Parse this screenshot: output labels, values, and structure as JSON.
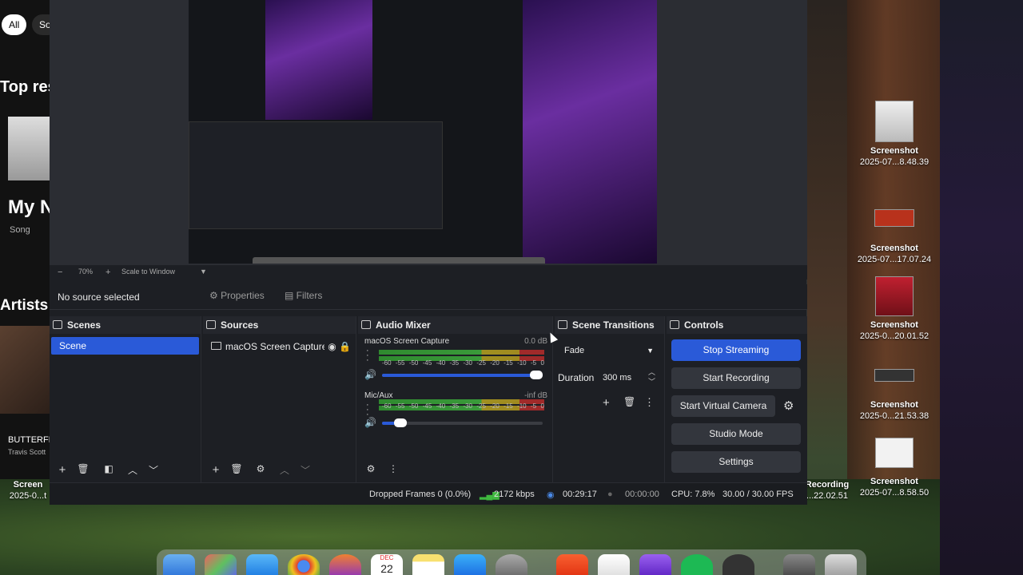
{
  "left_app": {
    "chip_all": "All",
    "chip_so": "So",
    "top_results": "Top res",
    "my": "My N",
    "song": "Song",
    "artists": "Artists",
    "now_playing_title": "BUTTERFL",
    "now_playing_artist": "Travis Scott"
  },
  "obs": {
    "zoom": "70%",
    "scale": "Scale to Window",
    "no_source": "No source selected",
    "properties": "Properties",
    "filters": "Filters",
    "scenes": {
      "title": "Scenes",
      "items": [
        "Scene"
      ]
    },
    "sources": {
      "title": "Sources",
      "items": [
        "macOS Screen Capture"
      ]
    },
    "mixer": {
      "title": "Audio Mixer",
      "channels": [
        {
          "name": "macOS Screen Capture",
          "db": "0.0 dB",
          "volume": 1.0
        },
        {
          "name": "Mic/Aux",
          "db": "-inf dB",
          "volume": 0.08
        }
      ],
      "ticks": [
        "-60",
        "-55",
        "-50",
        "-45",
        "-40",
        "-35",
        "-30",
        "-25",
        "-20",
        "-15",
        "-10",
        "-5",
        "0"
      ]
    },
    "transitions": {
      "title": "Scene Transitions",
      "type": "Fade",
      "duration_label": "Duration",
      "duration": "300 ms"
    },
    "controls": {
      "title": "Controls",
      "stop_streaming": "Stop Streaming",
      "start_recording": "Start Recording",
      "start_virtual_camera": "Start Virtual Camera",
      "studio_mode": "Studio Mode",
      "settings": "Settings"
    },
    "status": {
      "dropped": "Dropped Frames 0 (0.0%)",
      "bitrate": "2172 kbps",
      "stream_time": "00:29:17",
      "rec_time": "00:00:00",
      "cpu": "CPU: 7.8%",
      "fps": "30.00 / 30.00 FPS"
    }
  },
  "desktop_files": [
    {
      "name": "Screenshot",
      "date": "2025-07...8.48.39"
    },
    {
      "name": "Screenshot",
      "date": "2025-07...17.07.24"
    },
    {
      "name": "Screenshot",
      "date": "2025-0...20.01.52"
    },
    {
      "name": "Screenshot",
      "date": "2025-0...21.53.38"
    },
    {
      "name": "Screenshot",
      "date": "2025-07...8.58.50"
    }
  ],
  "left_desktop_file": {
    "name": "Screen",
    "date": "2025-0...t"
  },
  "recording_file": {
    "name": "Recording",
    "date": "...22.02.51"
  },
  "dock_calendar": {
    "month": "DEC",
    "day": "22"
  },
  "colors": {
    "accent": "#2a5ad8",
    "panel": "#1d1f24"
  }
}
